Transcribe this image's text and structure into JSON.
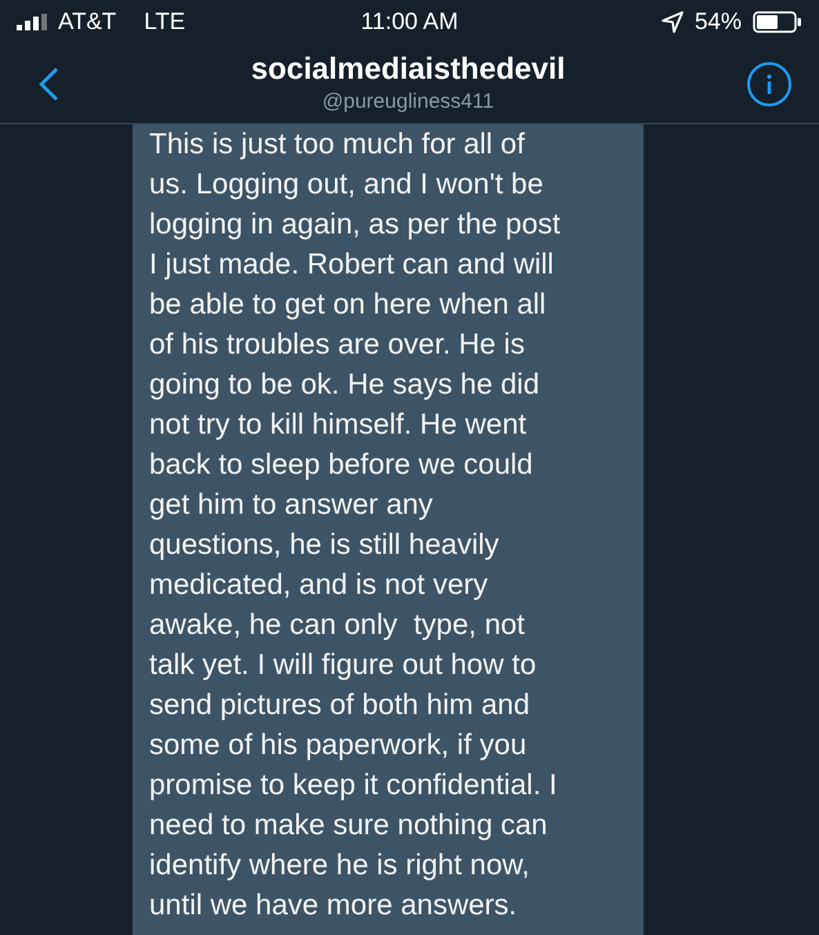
{
  "status_bar": {
    "carrier": "AT&T",
    "network": "LTE",
    "time": "11:00 AM",
    "battery": "54%"
  },
  "header": {
    "name": "socialmediaisthedevil",
    "handle": "@pureugliness411"
  },
  "message": {
    "lines": [
      "This is just too much for all of",
      "us. Logging out, and I won't be",
      "logging in again, as per the post",
      "I just made. Robert can and will",
      "be able to get on here when all",
      "of his troubles are over. He is",
      "going to be ok. He says he did",
      "not try to kill himself. He went",
      "back to sleep before we could",
      "get him to answer any",
      "questions, he is still heavily",
      "medicated, and is not very",
      "awake, he can only  type, not",
      "talk yet. I will figure out how to",
      "send pictures of both him and",
      "some of his paperwork, if you",
      "promise to keep it confidential. I",
      "need to make sure nothing can",
      "identify where he is right now,",
      "until we have more answers."
    ]
  }
}
